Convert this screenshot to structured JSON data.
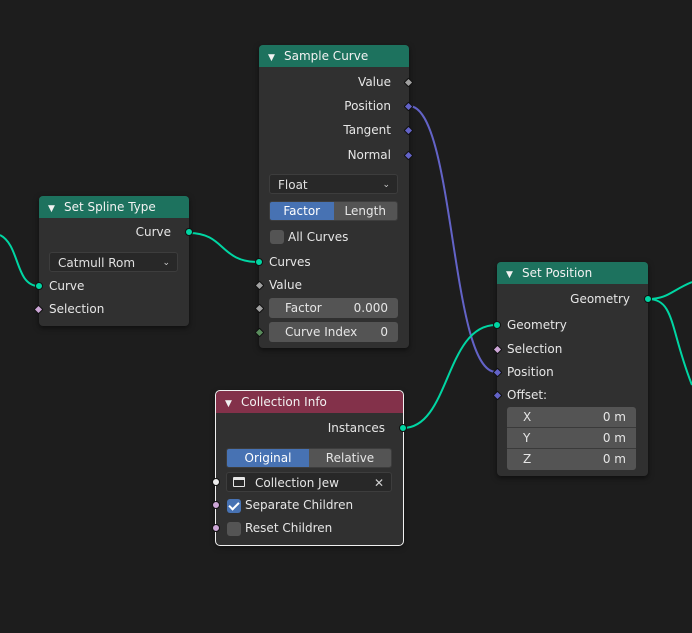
{
  "nodes": {
    "set_spline_type": {
      "title": "Set Spline Type",
      "output_curve": "Curve",
      "type_value": "Catmull Rom",
      "input_curve": "Curve",
      "input_selection": "Selection"
    },
    "sample_curve": {
      "title": "Sample Curve",
      "outputs": [
        "Value",
        "Position",
        "Tangent",
        "Normal"
      ],
      "data_type": "Float",
      "mode_options": [
        "Factor",
        "Length"
      ],
      "mode_selected": "Factor",
      "all_curves_label": "All Curves",
      "all_curves_checked": false,
      "input_curves": "Curves",
      "input_value": "Value",
      "factor_label": "Factor",
      "factor_value": "0.000",
      "curve_index_label": "Curve Index",
      "curve_index_value": "0"
    },
    "set_position": {
      "title": "Set Position",
      "output_geometry": "Geometry",
      "input_geometry": "Geometry",
      "input_selection": "Selection",
      "input_position": "Position",
      "offset_label": "Offset:",
      "offset": [
        {
          "axis": "X",
          "value": "0 m"
        },
        {
          "axis": "Y",
          "value": "0 m"
        },
        {
          "axis": "Z",
          "value": "0 m"
        }
      ]
    },
    "collection_info": {
      "title": "Collection Info",
      "output_instances": "Instances",
      "mode_options": [
        "Original",
        "Relative"
      ],
      "mode_selected": "Original",
      "collection_name": "Collection Jew",
      "separate_children_label": "Separate Children",
      "separate_children_checked": true,
      "reset_children_label": "Reset Children",
      "reset_children_checked": false
    }
  },
  "colors": {
    "background": "#1d1d1d",
    "node_body": "#303030",
    "geometry_header": "#1d725e",
    "input_header": "#83314a",
    "geometry_socket": "#00d6a3",
    "vector_socket": "#6363c7",
    "float_socket": "#a1a1a1",
    "bool_socket": "#cca6d6",
    "int_socket": "#598c5c",
    "accent_blue": "#4772b3"
  }
}
